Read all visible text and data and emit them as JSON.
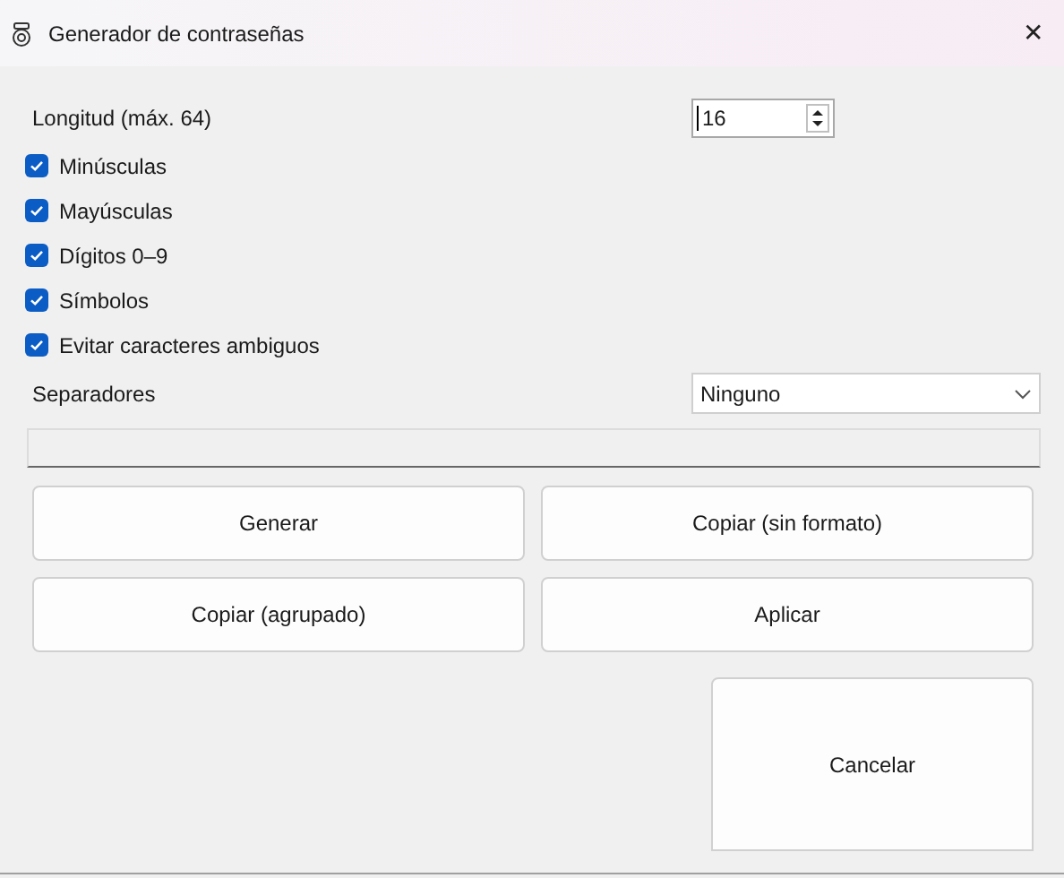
{
  "window": {
    "title": "Generador de contraseñas",
    "close": "✕"
  },
  "length": {
    "label": "Longitud (máx. 64)",
    "value": "16"
  },
  "options": [
    {
      "label": "Minúsculas",
      "checked": true
    },
    {
      "label": "Mayúsculas",
      "checked": true
    },
    {
      "label": "Dígitos 0–9",
      "checked": true
    },
    {
      "label": "Símbolos",
      "checked": true
    },
    {
      "label": "Evitar caracteres ambiguos",
      "checked": true
    }
  ],
  "separators": {
    "label": "Separadores",
    "value": "Ninguno"
  },
  "buttons": [
    "Generar",
    "Copiar (sin formato)",
    "Copiar (agrupado)",
    "Aplicar"
  ],
  "cancel_button": "Cancelar"
}
